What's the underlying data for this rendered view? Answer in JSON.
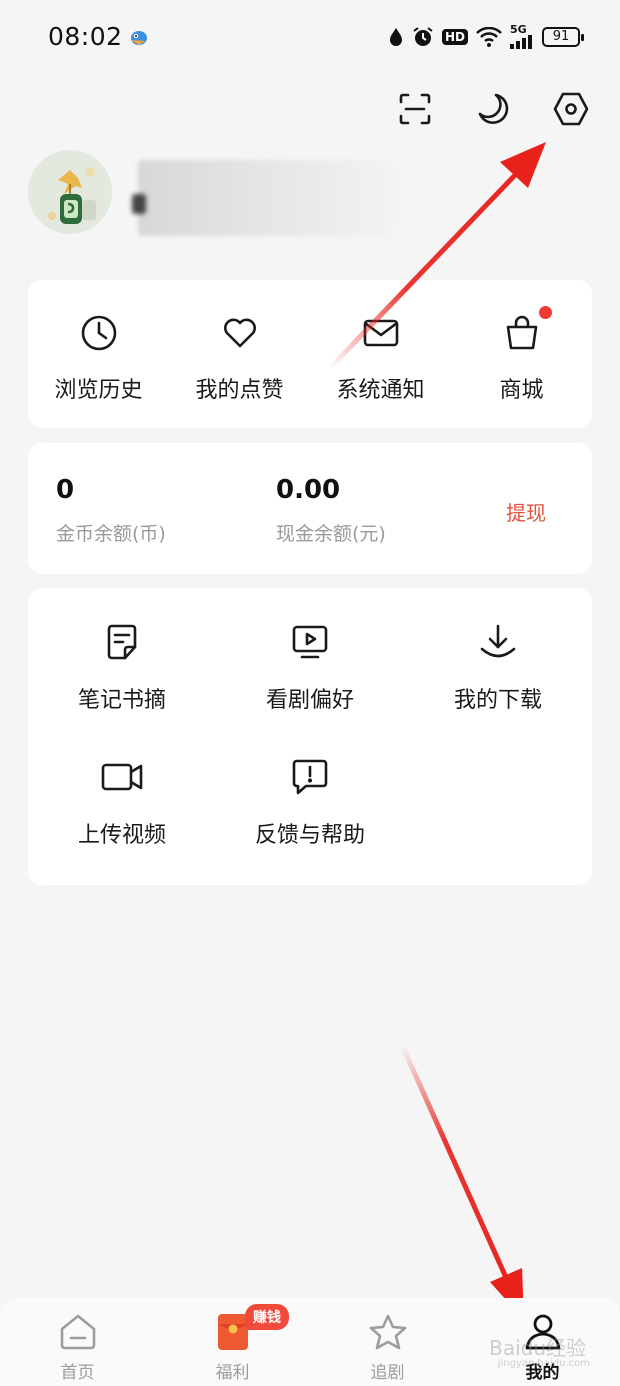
{
  "status_bar": {
    "time": "08:02",
    "hd": "HD",
    "network": "5G",
    "battery": "91"
  },
  "top_actions": {
    "icons": [
      "scan-icon",
      "night-mode-icon",
      "settings-icon"
    ]
  },
  "quick_links": [
    {
      "label": "浏览历史",
      "icon": "clock-icon"
    },
    {
      "label": "我的点赞",
      "icon": "heart-icon"
    },
    {
      "label": "系统通知",
      "icon": "mail-icon"
    },
    {
      "label": "商城",
      "icon": "shopping-bag-icon"
    }
  ],
  "balance": {
    "coins_value": "0",
    "coins_label": "金币余额(币)",
    "cash_value": "0.00",
    "cash_label": "现金余额(元)",
    "withdraw_label": "提现"
  },
  "tools": [
    {
      "label": "笔记书摘",
      "icon": "note-icon"
    },
    {
      "label": "看剧偏好",
      "icon": "tv-play-icon"
    },
    {
      "label": "我的下载",
      "icon": "download-icon"
    },
    {
      "label": "上传视频",
      "icon": "video-camera-icon"
    },
    {
      "label": "反馈与帮助",
      "icon": "feedback-icon"
    }
  ],
  "bottom_nav": [
    {
      "label": "首页",
      "icon": "home-icon"
    },
    {
      "label": "福利",
      "icon": "red-envelope-icon",
      "badge": "赚钱"
    },
    {
      "label": "追剧",
      "icon": "star-icon"
    },
    {
      "label": "我的",
      "icon": "person-icon",
      "active": true
    }
  ],
  "watermark": "Baidu经验",
  "watermark_sub": "jingyan.baidu.com",
  "colors": {
    "accent": "#e0533b",
    "badge": "#f04b3a",
    "notification_dot": "#ee3a33",
    "annotation_arrow": "#e8211b"
  }
}
